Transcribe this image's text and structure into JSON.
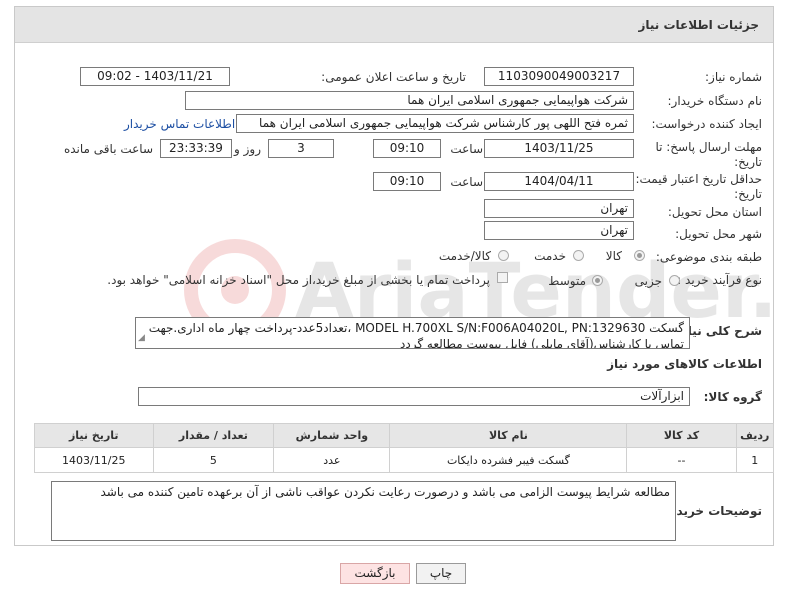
{
  "header": {
    "title": "جزئیات اطلاعات نیاز"
  },
  "fields": {
    "need_number_label": "شماره نیاز:",
    "need_number": "1103090049003217",
    "announce_label": "تاریخ و ساعت اعلان عمومی:",
    "announce_value": "1403/11/21 - 09:02",
    "buyer_org_label": "نام دستگاه خریدار:",
    "buyer_org": "شرکت هواپیمایی جمهوری اسلامی ایران هما",
    "requester_label": "ایجاد کننده درخواست:",
    "requester": "ثمره فتح اللهی پور کارشناس شرکت هواپیمایی جمهوری اسلامی ایران هما",
    "contact_link": "اطلاعات تماس خریدار",
    "reply_deadline_label": "مهلت ارسال پاسخ: تا",
    "reply_deadline_label2": "تاریخ:",
    "reply_date": "1403/11/25",
    "time_word": "ساعت",
    "reply_time": "09:10",
    "days": "3",
    "days_word": "روز و",
    "remaining": "23:33:39",
    "remaining_word": "ساعت باقی مانده",
    "price_valid_label": "حداقل تاریخ اعتبار قیمت: تا",
    "price_valid_label2": "تاریخ:",
    "price_date": "1404/04/11",
    "price_time": "09:10",
    "province_label": "استان محل تحویل:",
    "province": "تهران",
    "city_label": "شهر محل تحویل:",
    "city": "تهران",
    "category_label": "طبقه بندی موضوعی:",
    "category_options": [
      "کالا",
      "خدمت",
      "کالا/خدمت"
    ],
    "process_label": "نوع فرآیند خرید :",
    "process_options": [
      "جزیی",
      "متوسط"
    ],
    "payment_text": "پرداخت تمام یا بخشی از مبلغ خرید،از محل \"اسناد خزانه اسلامی\" خواهد بود.",
    "description_label": "شرح کلی نیاز:",
    "description": "گسکت MODEL H.700XL S/N:F006A04020L, PN:1329630 ،تعداد5عدد-پرداخت چهار ماه اداری.جهت تماس با کارشناس(آقای مایلی) فایل پیوست مطالعه گردد",
    "goods_info_title": "اطلاعات کالاهای مورد نیاز",
    "goods_group_label": "گروه کالا:",
    "goods_group": "ابزارآلات",
    "buyer_notes_label": "توضیحات خریدار:",
    "buyer_notes": "مطالعه شرایط پیوست الزامی می باشد و درصورت رعایت نکردن عواقب ناشی از آن برعهده تامین کننده می باشد"
  },
  "table": {
    "headers": [
      "ردیف",
      "کد کالا",
      "نام کالا",
      "واحد شمارش",
      "تعداد / مقدار",
      "تاریخ نیاز"
    ],
    "rows": [
      [
        "1",
        "--",
        "گسکت فیبر فشرده دایکات",
        "عدد",
        "5",
        "1403/11/25"
      ]
    ]
  },
  "buttons": {
    "print": "چاپ",
    "back": "بازگشت"
  },
  "watermark": "AriaTender.net",
  "colors": {
    "link": "#1d4fa3",
    "header_bg": "#e4e4e4",
    "back_button": "#fde3e3"
  }
}
